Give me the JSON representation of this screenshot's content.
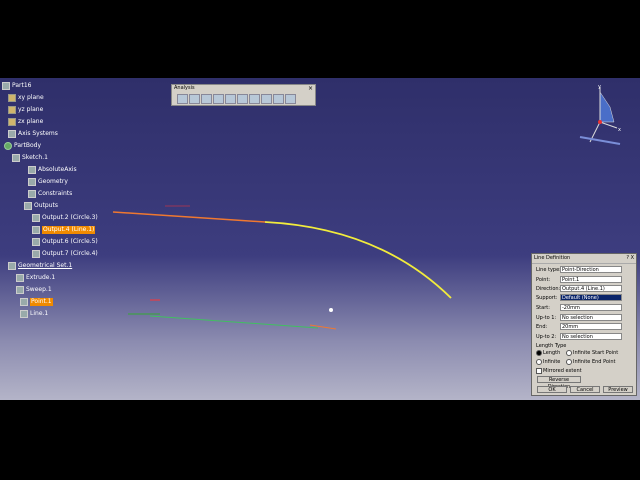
{
  "tree": [
    {
      "label": "Part16",
      "icon": "part-icon"
    },
    {
      "label": "xy plane",
      "icon": "plane-icon"
    },
    {
      "label": "yz plane",
      "icon": "plane-icon"
    },
    {
      "label": "zx plane",
      "icon": "plane-icon"
    },
    {
      "label": "Axis Systems",
      "icon": "axis-icon"
    },
    {
      "label": "PartBody",
      "icon": "gear-icon"
    },
    {
      "label": "Sketch.1",
      "icon": "sketch-icon"
    },
    {
      "label": "AbsoluteAxis",
      "icon": "axis-icon"
    },
    {
      "label": "Geometry",
      "icon": "geometry-icon"
    },
    {
      "label": "Constraints",
      "icon": "constraints-icon"
    },
    {
      "label": "Outputs",
      "icon": "folder-icon"
    },
    {
      "label": "Output.2 (Circle.3)",
      "icon": "output-icon"
    },
    {
      "label": "Output.4 (Line.1)",
      "icon": "output-icon"
    },
    {
      "label": "Output.6 (Circle.5)",
      "icon": "output-icon"
    },
    {
      "label": "Output.7 (Circle.4)",
      "icon": "output-icon"
    },
    {
      "label": "Geometrical Set.1",
      "icon": "geoset-icon"
    },
    {
      "label": "Extrude.1",
      "icon": "extrude-icon"
    },
    {
      "label": "Sweep.1",
      "icon": "sweep-icon"
    },
    {
      "label": "Point.1",
      "icon": "point-icon"
    },
    {
      "label": "Line.1",
      "icon": "line-icon"
    }
  ],
  "analysis_toolbar": {
    "title": "Analysis",
    "close": "×",
    "tools": [
      "connect-checker-icon",
      "feature-draft-icon",
      "draft-analysis-icon",
      "curvature-analysis-icon",
      "distance-analysis-icon",
      "cutting-plane-icon",
      "reflection-lines-icon",
      "inflection-lines-icon",
      "highlight-lines-icon",
      "porcupine-icon"
    ]
  },
  "dialog": {
    "title": "Line Definition",
    "title_buttons": "? X",
    "line_type_label": "Line type:",
    "line_type_value": "Point-Direction",
    "point_label": "Point:",
    "point_value": "Point.1",
    "direction_label": "Direction:",
    "direction_value": "Output.4 (Line.1)",
    "support_label": "Support:",
    "support_value": "Default (None)",
    "start_label": "Start:",
    "start_value": "-20mm",
    "upto1_label": "Up-to 1:",
    "upto1_value": "No selection",
    "end_label": "End:",
    "end_value": "20mm",
    "upto2_label": "Up-to 2:",
    "upto2_value": "No selection",
    "length_type_label": "Length Type",
    "opt_length": "Length",
    "opt_infinite_start": "Infinite Start Point",
    "opt_infinite": "Infinite",
    "opt_infinite_end": "Infinite End Point",
    "mirrored": "Mirrored extent",
    "reverse": "Reverse Direction",
    "ok": "OK",
    "cancel": "Cancel",
    "preview": "Preview"
  },
  "compass": {
    "y_label": "y",
    "x_label": "x",
    "z_label": "z"
  },
  "colors": {
    "background_top": "#2f2f6a",
    "orange_curve": "#f07830",
    "yellow_curve": "#f2ec3c",
    "selection": "#f08a00",
    "green_line": "#40c060"
  }
}
